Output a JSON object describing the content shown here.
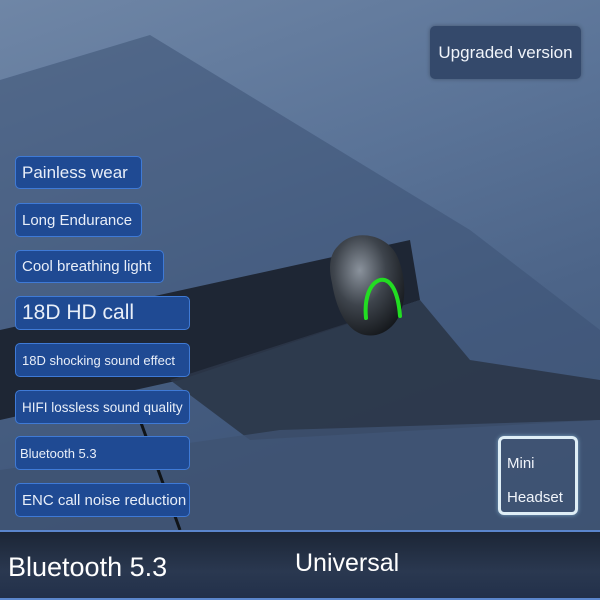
{
  "badge_top": "Upgraded version",
  "features": [
    "Painless wear",
    "Long Endurance",
    "Cool breathing light",
    "18D HD call",
    "18D shocking sound effect",
    "HIFI lossless sound quality",
    "Bluetooth 5.3",
    "ENC call noise reduction"
  ],
  "mini_badge": {
    "line1": "Mini",
    "line2": "Headset"
  },
  "bottom_bar": {
    "left": "Bluetooth 5.3",
    "center": "Universal"
  },
  "colors": {
    "tag_bg": "#1f4a93",
    "tag_border": "#3f7ad6",
    "light_accent": "#22dd22"
  }
}
